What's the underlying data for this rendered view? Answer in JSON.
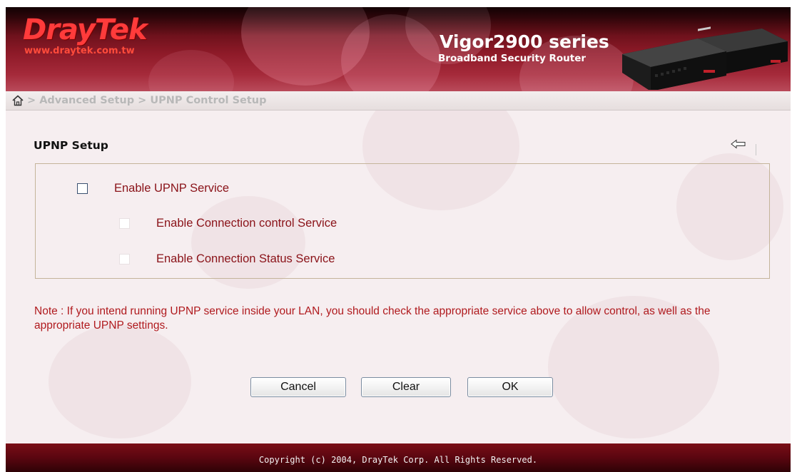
{
  "brand": {
    "logo_text": "DrayTek",
    "url_text": "www.draytek.com.tw",
    "product_title": "Vigor2900 series",
    "product_subtitle": "Broadband Security Router",
    "accent_color": "#8e1a28",
    "logo_color": "#ff3b3b"
  },
  "breadcrumb": {
    "home_icon": "home-icon",
    "text": "> Advanced Setup > UPNP Control Setup"
  },
  "section": {
    "title": "UPNP Setup",
    "back_icon": "back-arrow-icon"
  },
  "options": [
    {
      "label": "Enable UPNP Service",
      "checked": false,
      "enabled": true
    },
    {
      "label": "Enable Connection control Service",
      "checked": false,
      "enabled": false
    },
    {
      "label": "Enable Connection Status Service",
      "checked": false,
      "enabled": false
    }
  ],
  "note": "Note : If you intend running UPNP service inside your LAN, you should check the appropriate service above to allow control, as well as the appropriate UPNP settings.",
  "buttons": {
    "cancel": "Cancel",
    "clear": "Clear",
    "ok": "OK"
  },
  "footer": {
    "copyright": "Copyright (c) 2004, DrayTek Corp. All Rights Reserved."
  }
}
